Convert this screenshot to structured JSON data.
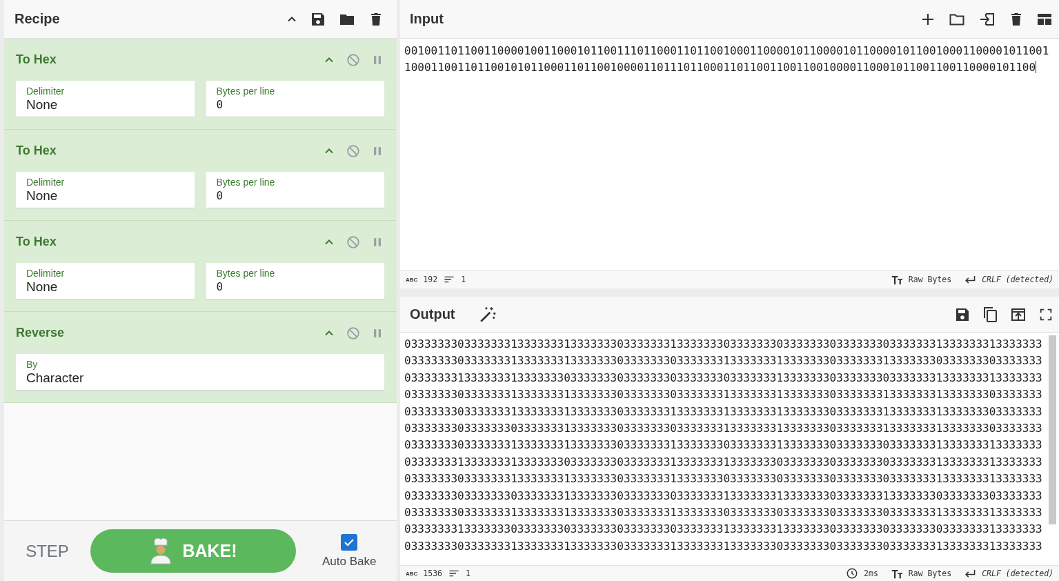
{
  "recipe": {
    "title": "Recipe",
    "operations": [
      {
        "name": "To Hex",
        "fields": [
          {
            "kind": "select",
            "label": "Delimiter",
            "value": "None"
          },
          {
            "kind": "number",
            "label": "Bytes per line",
            "value": "0"
          }
        ]
      },
      {
        "name": "To Hex",
        "fields": [
          {
            "kind": "select",
            "label": "Delimiter",
            "value": "None"
          },
          {
            "kind": "number",
            "label": "Bytes per line",
            "value": "0"
          }
        ]
      },
      {
        "name": "To Hex",
        "fields": [
          {
            "kind": "select",
            "label": "Delimiter",
            "value": "None"
          },
          {
            "kind": "number",
            "label": "Bytes per line",
            "value": "0"
          }
        ]
      },
      {
        "name": "Reverse",
        "fields": [
          {
            "kind": "select",
            "label": "By",
            "value": "Character"
          }
        ]
      }
    ]
  },
  "controls": {
    "step": "STEP",
    "bake": "BAKE!",
    "auto_bake": {
      "label": "Auto Bake",
      "checked": true
    }
  },
  "input": {
    "title": "Input",
    "text": "001001101100110000100110001011001110110001101100100011000010110000101100001011001000110000101100110001100110110010101100011011001000011011101100011011001100110010000110001011001100110000101100",
    "status": {
      "length_icon": "ABC",
      "length": "192",
      "lines": "1",
      "encoding": "Raw Bytes",
      "eol": "CRLF (detected)"
    }
  },
  "output": {
    "title": "Output",
    "lines": [
      "033333330333333313333333133333330333333313333333033333330333333303333333033333331333333313333333",
      "033333330333333313333333133333330333333303333333133333331333333303333333133333330333333303333333",
      "033333331333333313333333033333330333333303333333033333331333333303333333033333331333333313333333",
      "033333330333333313333333133333330333333303333333133333331333333303333333133333331333333303333333",
      "033333330333333313333333133333330333333313333333133333331333333303333333133333331333333303333333",
      "033333330333333303333333133333330333333303333333133333331333333303333333133333331333333303333333",
      "033333330333333313333333133333330333333313333333033333331333333303333333033333331333333313333333",
      "033333331333333313333333033333330333333313333333133333330333333303333333033333331333333313333333",
      "033333330333333313333333133333330333333313333333033333330333333303333333033333331333333313333333",
      "033333330333333303333333133333330333333303333333133333331333333303333333133333330333333303333333",
      "033333330333333313333333133333330333333313333333033333330333333303333333033333331333333313333333",
      "033333331333333303333333033333330333333303333333133333331333333303333333033333330333333313333333",
      "033333330333333313333333133333330333333313333333133333330333333303333333033333331333333313333333"
    ],
    "status": {
      "length_icon": "ABC",
      "length": "1536",
      "lines": "1",
      "time": "2ms",
      "encoding": "Raw Bytes",
      "eol": "CRLF (detected)"
    }
  }
}
